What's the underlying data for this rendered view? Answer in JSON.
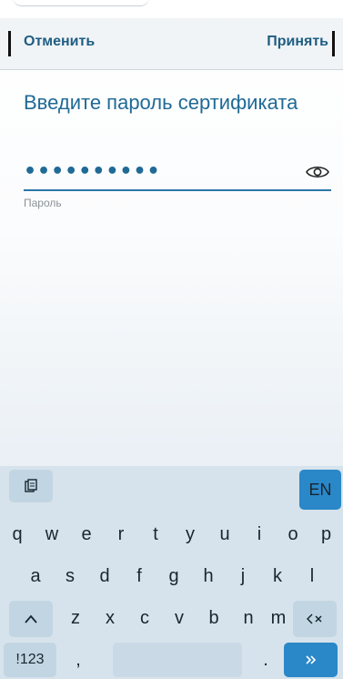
{
  "header": {
    "cancel_label": "Отменить",
    "accept_label": "Принять"
  },
  "prompt": {
    "title": "Введите пароль сертификата"
  },
  "password": {
    "value": "••••••••••",
    "label": "Пароль"
  },
  "keyboard": {
    "clipboard_icon": "clipboard-icon",
    "language": "EN",
    "row1": [
      "q",
      "w",
      "e",
      "r",
      "t",
      "y",
      "u",
      "i",
      "o",
      "p"
    ],
    "row2": [
      "a",
      "s",
      "d",
      "f",
      "g",
      "h",
      "j",
      "k",
      "l"
    ],
    "row3": [
      "z",
      "x",
      "c",
      "v",
      "b",
      "n",
      "m"
    ],
    "shift_icon": "caret-up-icon",
    "backspace_icon": "backspace-icon",
    "symbols_label": "!123",
    "comma": ",",
    "period": ".",
    "enter_icon": "double-chevron-right-icon"
  },
  "colors": {
    "accent": "#2a87c8",
    "text": "#1f5d82"
  }
}
